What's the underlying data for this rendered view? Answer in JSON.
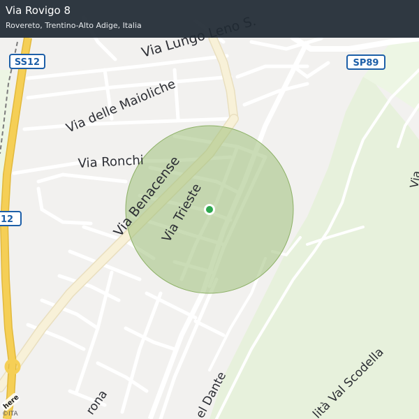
{
  "header": {
    "title": "Via Rovigo 8",
    "subtitle": "Rovereto, Trentino-Alto Adige, Italia"
  },
  "streets": {
    "via_lungo_leno": "Via Lungo Leno S.",
    "via_delle_maioliche": "Via delle Maioliche",
    "via_ronchi": "Via Ronchi",
    "via_benacense": "Via Benacense",
    "via_trieste": "Via Trieste",
    "via_dante": "el Dante",
    "via_val_scodella": "lità Val Scodella",
    "via_verona": "rona",
    "via_right_edge": "Via"
  },
  "shields": {
    "ss12_top": "SS12",
    "sp89": "SP89",
    "ss12_left": "12"
  },
  "marker": {
    "accuracy_color": "#9fc07a",
    "dot_color": "#2fa84f"
  },
  "branding": {
    "logo": "here",
    "copyright": "©ITA"
  },
  "icons": {
    "location_marker": "location-dot-icon",
    "logo": "here-logo-icon"
  }
}
